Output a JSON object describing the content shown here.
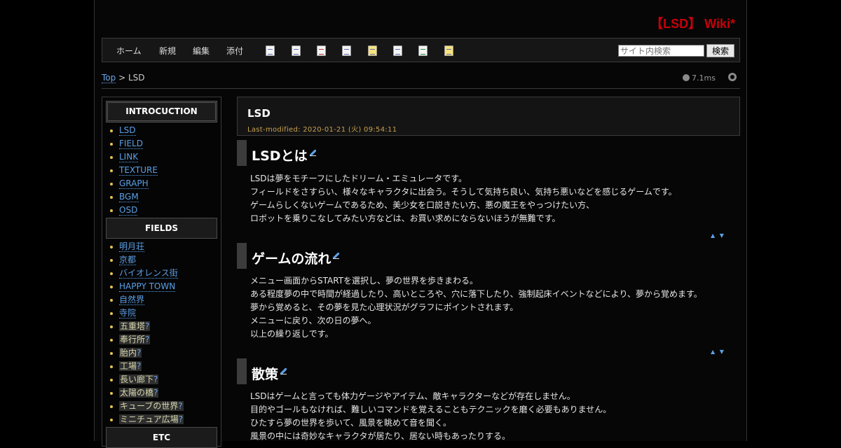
{
  "site": {
    "title": "【LSD】 Wiki*"
  },
  "nav": {
    "links": [
      "ホーム",
      "新規",
      "編集",
      "添付"
    ],
    "tool_icons": [
      "copy-page-icon",
      "diff-icon",
      "backup-icon",
      "freeze-icon",
      "lock-icon",
      "rename-icon",
      "recent-icon",
      "help-icon"
    ],
    "search_placeholder": "サイト内検索",
    "search_button": "検索"
  },
  "breadcrumb": {
    "top": "Top",
    "separator": ">",
    "current": "LSD"
  },
  "timing": "7.1ms",
  "menu": {
    "sections": [
      {
        "heading": "INTROCUCTION",
        "items": [
          {
            "label": "LSD",
            "exists": true
          },
          {
            "label": "FIELD",
            "exists": true
          },
          {
            "label": "LINK",
            "exists": true
          },
          {
            "label": "TEXTURE",
            "exists": true
          },
          {
            "label": "GRAPH",
            "exists": true
          },
          {
            "label": "BGM",
            "exists": true
          },
          {
            "label": "OSD",
            "exists": true
          }
        ]
      },
      {
        "heading": "FIELDS",
        "items": [
          {
            "label": "明月荘",
            "exists": true
          },
          {
            "label": "京都",
            "exists": true
          },
          {
            "label": "バイオレンス街",
            "exists": true
          },
          {
            "label": "HAPPY TOWN",
            "exists": true
          },
          {
            "label": "自然界",
            "exists": true
          },
          {
            "label": "寺院",
            "exists": true
          },
          {
            "label": "五重塔",
            "exists": false
          },
          {
            "label": "奉行所",
            "exists": false
          },
          {
            "label": "胎内",
            "exists": false
          },
          {
            "label": "工場",
            "exists": false
          },
          {
            "label": "長い廊下",
            "exists": false
          },
          {
            "label": "太陽の橋",
            "exists": false
          },
          {
            "label": "キューブの世界",
            "exists": false
          },
          {
            "label": "ミニチュア広場",
            "exists": false
          }
        ]
      },
      {
        "heading": "ETC",
        "items": []
      }
    ],
    "missing_mark": "?"
  },
  "page": {
    "title": "LSD",
    "last_modified": "Last-modified: 2020-01-21 (火) 09:54:11"
  },
  "sections": [
    {
      "heading": "LSDとは",
      "lines": [
        "LSDは夢をモチーフにしたドリーム・エミュレータです。",
        "フィールドをさすらい、様々なキャラクタに出会う。そうして気持ち良い、気持ち悪いなどを感じるゲームです。",
        "ゲームらしくないゲームであるため、美少女を口説きたい方、悪の魔王をやっつけたい方、",
        "ロボットを乗りこなしてみたい方などは、お買い求めにならないほうが無難です。"
      ]
    },
    {
      "heading": "ゲームの流れ",
      "lines": [
        "メニュー画面からSTARTを選択し、夢の世界を歩きまわる。",
        "ある程度夢の中で時間が経過したり、高いところや、穴に落下したり、強制起床イベントなどにより、夢から覚めます。",
        "夢から覚めると、その夢を見た心理状況がグラフにポイントされます。",
        "メニューに戻り、次の日の夢へ。",
        "以上の繰り返しです。"
      ]
    },
    {
      "heading": "散策",
      "lines": [
        "LSDはゲームと言っても体力ゲージやアイテム、敵キャラクターなどが存在しません。",
        "目的やゴールもなければ、難しいコマンドを覚えることもテクニックを磨く必要もありません。",
        "ひたすら夢の世界を歩いて、風景を眺めて音を聞く。",
        "風景の中には奇妙なキャラクタが居たり、居ない時もあったりする。"
      ]
    }
  ],
  "jump_marks": "▲ ▼"
}
